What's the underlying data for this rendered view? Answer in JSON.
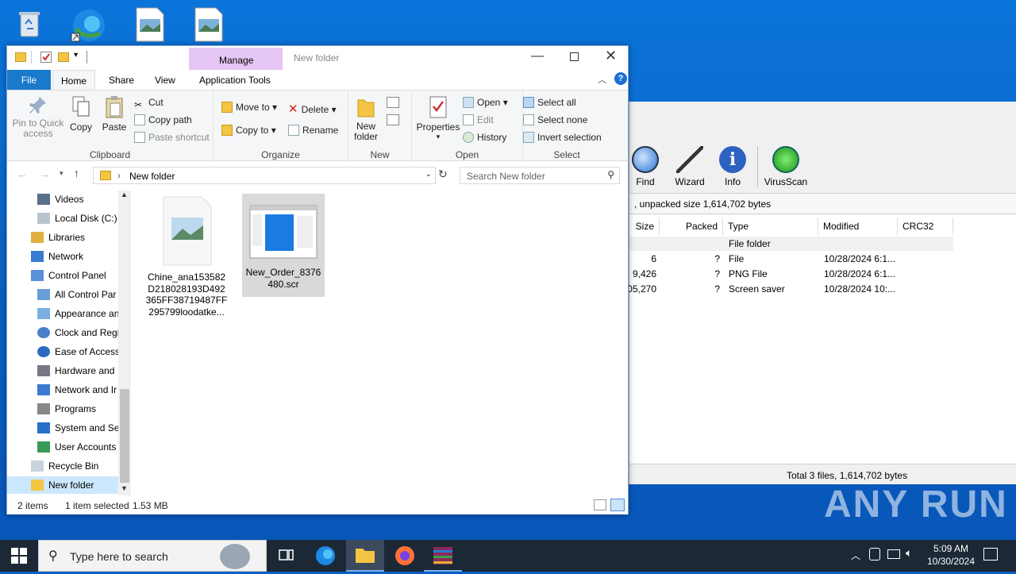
{
  "desktop": {
    "icons": [
      "recycle-bin-icon",
      "edge-icon",
      "image-file-icon",
      "image-file-icon"
    ]
  },
  "winrar": {
    "toolbar": [
      {
        "label": "Find",
        "icon": "find-icon"
      },
      {
        "label": "Wizard",
        "icon": "wizard-icon"
      },
      {
        "label": "Info",
        "icon": "info-icon"
      },
      {
        "label": "VirusScan",
        "icon": "virusscan-icon"
      }
    ],
    "path_text": ", unpacked size 1,614,702 bytes",
    "columns": [
      "Size",
      "Packed",
      "Type",
      "Modified",
      "CRC32"
    ],
    "rows": [
      {
        "size": "",
        "packed": "",
        "type": "File folder",
        "modified": ""
      },
      {
        "size": "6",
        "packed": "?",
        "type": "File",
        "modified": "10/28/2024 6:1..."
      },
      {
        "size": "9,426",
        "packed": "?",
        "type": "PNG File",
        "modified": "10/28/2024 6:1..."
      },
      {
        "size": "05,270",
        "packed": "?",
        "type": "Screen saver",
        "modified": "10/28/2024 10:..."
      }
    ],
    "status": "Total 3 files, 1,614,702 bytes"
  },
  "explorer": {
    "title": "New folder",
    "manage_label": "Manage",
    "tabs": {
      "file": "File",
      "home": "Home",
      "share": "Share",
      "view": "View",
      "app_tools": "Application Tools"
    },
    "help": "?",
    "ribbon": {
      "clipboard": {
        "pin": "Pin to Quick access",
        "copy": "Copy",
        "paste": "Paste",
        "cut": "Cut",
        "copy_path": "Copy path",
        "paste_shortcut": "Paste shortcut",
        "label": "Clipboard"
      },
      "organize": {
        "move_to": "Move to",
        "copy_to": "Copy to",
        "delete": "Delete",
        "rename": "Rename",
        "label": "Organize"
      },
      "new": {
        "new_folder": "New folder",
        "label": "New"
      },
      "open": {
        "properties": "Properties",
        "open": "Open",
        "edit": "Edit",
        "history": "History",
        "label": "Open"
      },
      "select": {
        "select_all": "Select all",
        "select_none": "Select none",
        "invert": "Invert selection",
        "label": "Select"
      }
    },
    "address": {
      "crumb": "New folder",
      "search_placeholder": "Search New folder"
    },
    "nav": [
      {
        "label": "Videos",
        "icon": "videos-icon"
      },
      {
        "label": "Local Disk (C:)",
        "icon": "disk-icon"
      },
      {
        "label": "Libraries",
        "icon": "libraries-icon"
      },
      {
        "label": "Network",
        "icon": "network-icon"
      },
      {
        "label": "Control Panel",
        "icon": "control-panel-icon"
      },
      {
        "label": "All Control Par",
        "icon": "all-control-icon"
      },
      {
        "label": "Appearance an",
        "icon": "appearance-icon"
      },
      {
        "label": "Clock and Regi",
        "icon": "clock-icon"
      },
      {
        "label": "Ease of Access",
        "icon": "ease-icon"
      },
      {
        "label": "Hardware and",
        "icon": "hardware-icon"
      },
      {
        "label": "Network and Ir",
        "icon": "network-internet-icon"
      },
      {
        "label": "Programs",
        "icon": "programs-icon"
      },
      {
        "label": "System and Sec",
        "icon": "system-icon"
      },
      {
        "label": "User Accounts",
        "icon": "users-icon"
      },
      {
        "label": "Recycle Bin",
        "icon": "recycle-bin-icon"
      },
      {
        "label": "New folder",
        "icon": "folder-icon"
      }
    ],
    "files": [
      {
        "name_lines": [
          "Chine_ana153582",
          "D218028193D492",
          "365FF38719487FF",
          "295799loodatke..."
        ],
        "selected": false
      },
      {
        "name_lines": [
          "New_Order_8376",
          "480.scr"
        ],
        "selected": true
      }
    ],
    "status": {
      "items": "2 items",
      "selected": "1 item selected",
      "size": "1.53 MB"
    }
  },
  "taskbar": {
    "search_placeholder": "Type here to search",
    "time": "5:09 AM",
    "date": "10/30/2024"
  },
  "watermark": "ANY RUN"
}
